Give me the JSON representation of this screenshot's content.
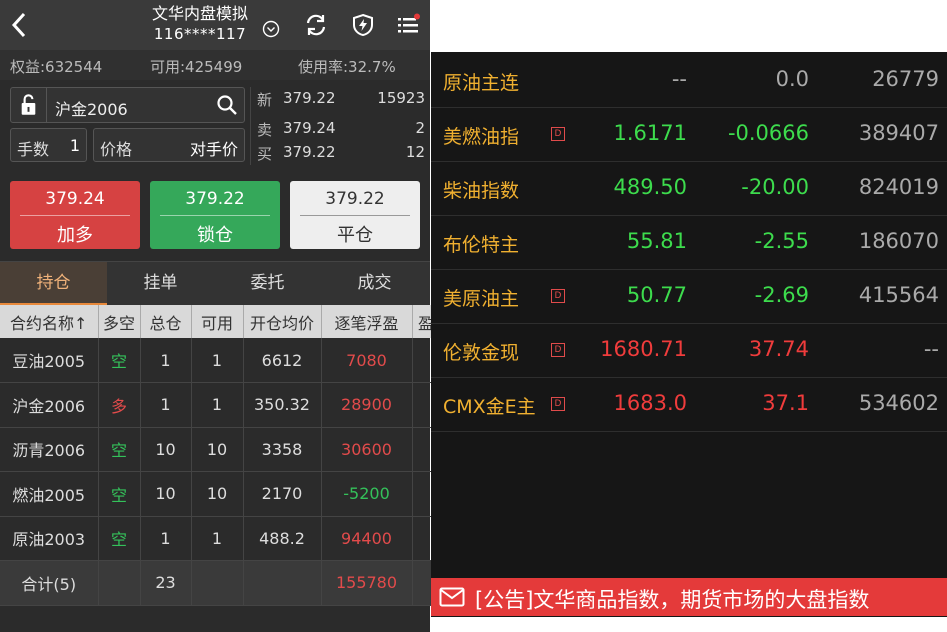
{
  "header": {
    "title": "文华内盘模拟",
    "account_id": "116****117"
  },
  "account": {
    "equity": "权益:632544",
    "available": "可用:425499",
    "usage": "使用率:32.7%"
  },
  "order": {
    "symbol": "沪金2006",
    "qty_label": "手数",
    "qty_value": "1",
    "price_label": "价格",
    "price_value": "对手价"
  },
  "quote": [
    {
      "k": "新",
      "p": "379.22",
      "v": "15923"
    },
    {
      "k": "卖",
      "p": "379.24",
      "v": "2"
    },
    {
      "k": "买",
      "p": "379.22",
      "v": "12"
    }
  ],
  "buttons": [
    {
      "price": "379.24",
      "label": "加多"
    },
    {
      "price": "379.22",
      "label": "锁仓"
    },
    {
      "price": "379.22",
      "label": "平仓"
    }
  ],
  "tabs": [
    "持仓",
    "挂单",
    "委托",
    "成交"
  ],
  "positions": {
    "headers": [
      "合约名称↑",
      "多空",
      "总仓",
      "可用",
      "开仓均价",
      "逐笔浮盈",
      "盈"
    ],
    "rows": [
      {
        "name": "豆油2005",
        "dir": "空",
        "total": "1",
        "avail": "1",
        "avg": "6612",
        "pnl": "7080"
      },
      {
        "name": "沪金2006",
        "dir": "多",
        "total": "1",
        "avail": "1",
        "avg": "350.32",
        "pnl": "28900"
      },
      {
        "name": "沥青2006",
        "dir": "空",
        "total": "10",
        "avail": "10",
        "avg": "3358",
        "pnl": "30600"
      },
      {
        "name": "燃油2005",
        "dir": "空",
        "total": "10",
        "avail": "10",
        "avg": "2170",
        "pnl": "-5200"
      },
      {
        "name": "原油2003",
        "dir": "空",
        "total": "1",
        "avail": "1",
        "avg": "488.2",
        "pnl": "94400"
      }
    ],
    "total": {
      "label": "合计(5)",
      "total": "23",
      "pnl": "155780"
    }
  },
  "market": [
    {
      "name": "原油主连",
      "tag": "",
      "last": "--",
      "change": "0.0",
      "volume": "26779"
    },
    {
      "name": "美燃油指",
      "tag": "D",
      "last": "1.6171",
      "change": "-0.0666",
      "volume": "389407"
    },
    {
      "name": "柴油指数",
      "tag": "",
      "last": "489.50",
      "change": "-20.00",
      "volume": "824019"
    },
    {
      "name": "布伦特主",
      "tag": "",
      "last": "55.81",
      "change": "-2.55",
      "volume": "186070"
    },
    {
      "name": "美原油主",
      "tag": "D",
      "last": "50.77",
      "change": "-2.69",
      "volume": "415564"
    },
    {
      "name": "伦敦金现",
      "tag": "D",
      "last": "1680.71",
      "change": "37.74",
      "volume": "--"
    },
    {
      "name": "CMX金E主",
      "tag": "D",
      "last": "1683.0",
      "change": "37.1",
      "volume": "534602"
    }
  ],
  "notice": {
    "text": "[公告]文华商品指数，期货市场的大盘指数"
  },
  "colors": {
    "up": "#f03c3c",
    "down": "#3ddc4d",
    "flat": "#aaaaaa",
    "accent": "#e8893b",
    "name": "#f0b030"
  },
  "icons": [
    "back-icon",
    "chevron-down-icon",
    "refresh-icon",
    "shield-flash-icon",
    "menu-list-icon",
    "lock-icon",
    "search-icon",
    "mail-icon"
  ]
}
